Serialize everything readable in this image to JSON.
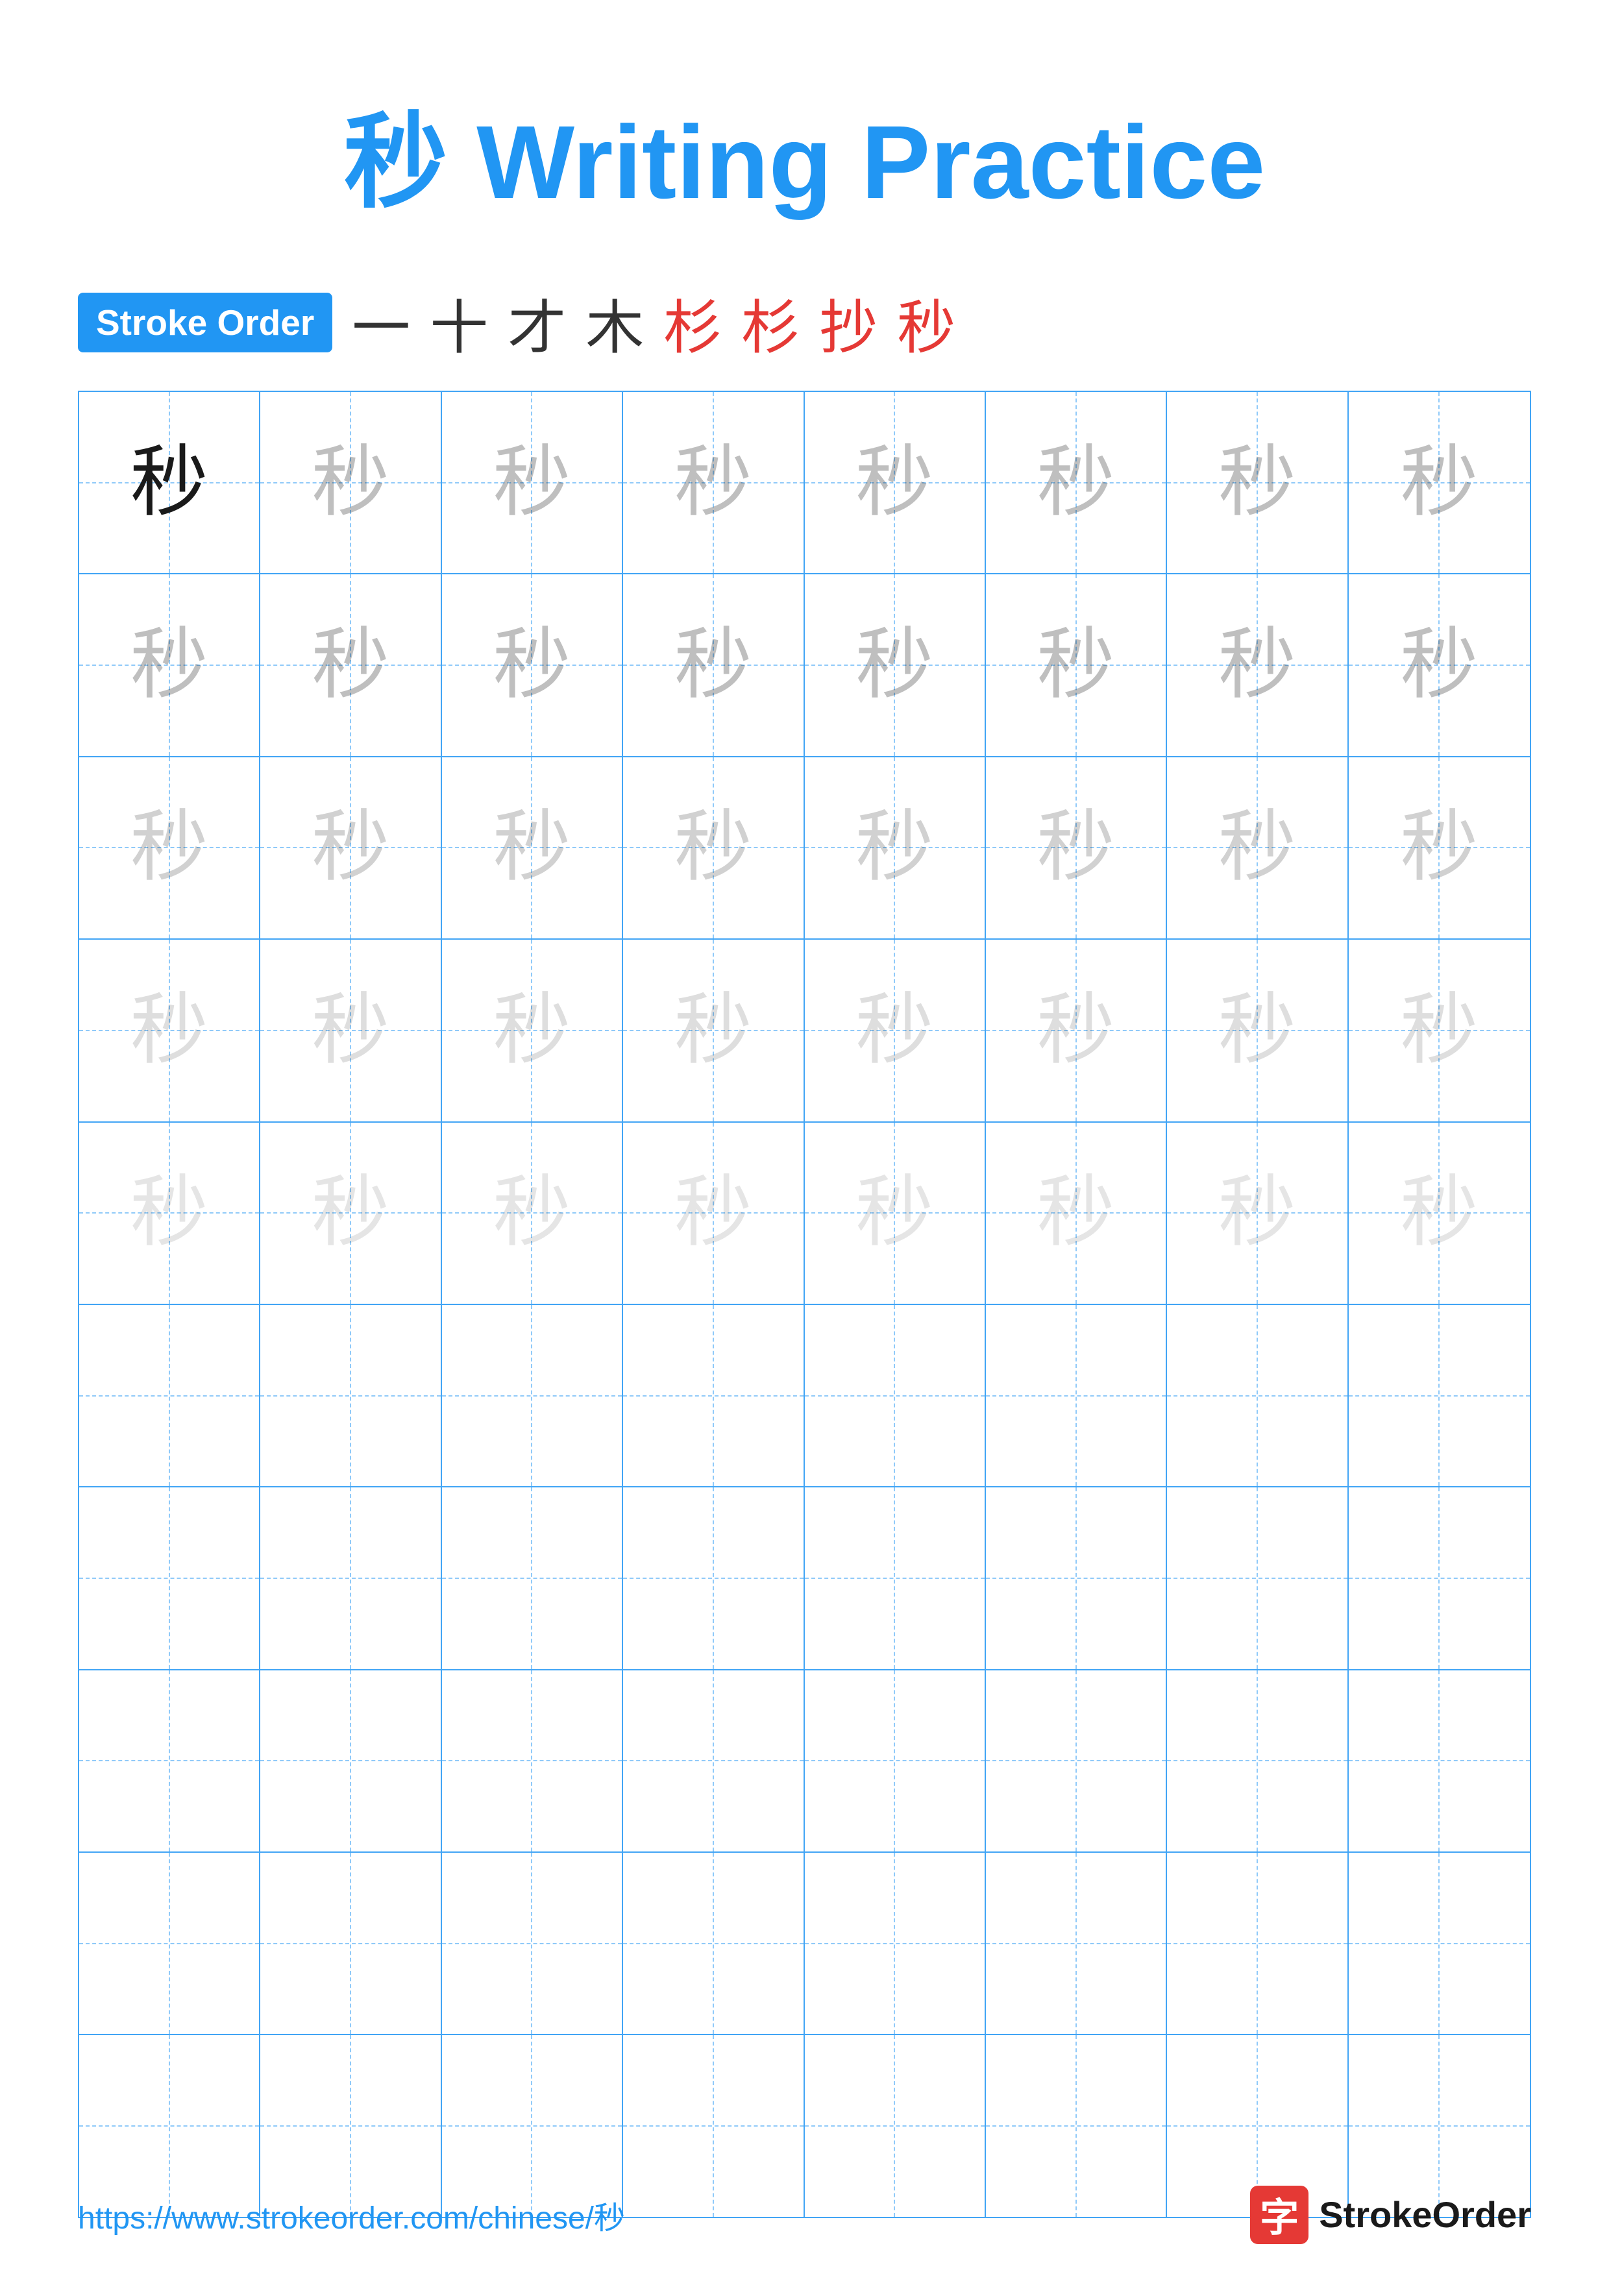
{
  "page": {
    "title": "Writing Practice",
    "title_char": "秒",
    "title_color": "#2196F3"
  },
  "stroke_order": {
    "badge_label": "Stroke Order",
    "strokes": [
      "一",
      "十",
      "才",
      "木",
      "杉",
      "杉",
      "抄",
      "秒"
    ]
  },
  "grid": {
    "rows": 10,
    "cols": 8,
    "character": "秒",
    "practice_rows": 5,
    "empty_rows": 5
  },
  "footer": {
    "url": "https://www.strokeorder.com/chinese/秒",
    "brand_char": "字",
    "brand_name": "StrokeOrder"
  }
}
